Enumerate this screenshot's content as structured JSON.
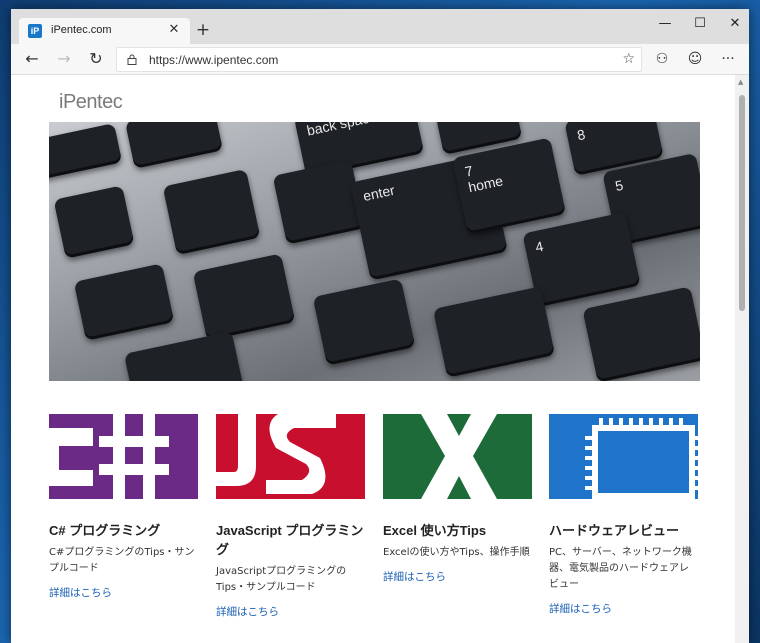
{
  "tab": {
    "favicon": "iP",
    "title": "iPentec.com",
    "close": "✕"
  },
  "new_tab": "+",
  "window_controls": {
    "minimize": "—",
    "maximize": "☐",
    "close": "✕"
  },
  "nav": {
    "back": "←",
    "forward": "→",
    "refresh": "↻"
  },
  "address": {
    "url": "https://www.ipentec.com"
  },
  "toolbar": {
    "favorite": "☆",
    "profile": "⚇",
    "feedback": "☺",
    "more": "···"
  },
  "page": {
    "logo": "iPentec",
    "hero_keys": {
      "backspace": "back space",
      "enter": "enter",
      "home": "home",
      "seven": "7",
      "four": "4",
      "five": "5",
      "eight": "8"
    },
    "cards": [
      {
        "title": "C# プログラミング",
        "desc": "C#プログラミングのTips・サンプルコード",
        "link": "詳細はこちら",
        "logo_text": "C#",
        "color": "#6b2a86"
      },
      {
        "title": "JavaScript プログラミング",
        "desc": "JavaScriptプログラミングのTips・サンプルコード",
        "link": "詳細はこちら",
        "logo_text": "JS",
        "color": "#c8102e"
      },
      {
        "title": "Excel 使い方Tips",
        "desc": "Excelの使い方やTips、操作手順",
        "link": "詳細はこちら",
        "logo_text": "X",
        "color": "#1e6b3a"
      },
      {
        "title": "ハードウェアレビュー",
        "desc": "PC、サーバー、ネットワーク機器、電気製品のハードウェアレビュー",
        "link": "詳細はこちら",
        "logo_text": "",
        "color": "#1f74c9"
      }
    ]
  }
}
